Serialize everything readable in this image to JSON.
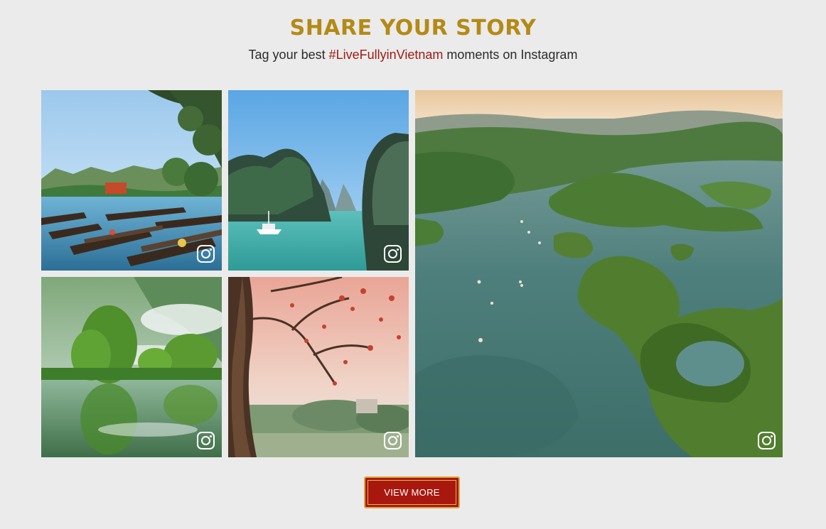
{
  "section": {
    "title": "SHARE YOUR STORY",
    "subtitle_before": "Tag your best ",
    "hashtag": "#LiveFullyinVietnam",
    "subtitle_after": " moments on Instagram"
  },
  "gallery": {
    "items": [
      {
        "icon": "instagram-icon"
      },
      {
        "icon": "instagram-icon"
      },
      {
        "icon": "instagram-icon"
      },
      {
        "icon": "instagram-icon"
      },
      {
        "icon": "instagram-icon"
      }
    ]
  },
  "button": {
    "label": "VIEW MORE"
  },
  "colors": {
    "background": "#ebebeb",
    "heading": "#b48a16",
    "hashtag": "#9b1b14",
    "button_bg": "#a8180f",
    "button_border": "#d9a93b"
  }
}
